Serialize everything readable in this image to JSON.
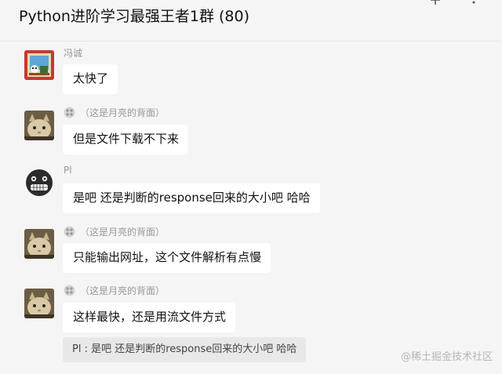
{
  "header": {
    "title": "Python进阶学习最强王者1群 (80)"
  },
  "messages": [
    {
      "sender": "冯诚",
      "text": "太快了",
      "avatar": "cartoon-avatar-icon"
    },
    {
      "sender": "（这是月亮的背面）",
      "text": "但是文件下载不下来",
      "avatar": "cat-avatar-icon"
    },
    {
      "sender": "Pl",
      "text": "是吧 还是判断的response回来的大小吧 哈哈",
      "avatar": "grinning-face-avatar-icon"
    },
    {
      "sender": "（这是月亮的背面）",
      "text": "只能输出网址，这个文件解析有点慢",
      "avatar": "cat-avatar-icon"
    },
    {
      "sender": "（这是月亮的背面）",
      "text": "这样最快，还是用流文件方式",
      "avatar": "cat-avatar-icon"
    }
  ],
  "quote": {
    "text": "Pl : 是吧 还是判断的response回来的大小吧 哈哈"
  },
  "watermark": {
    "text": "@稀土掘金技术社区"
  }
}
